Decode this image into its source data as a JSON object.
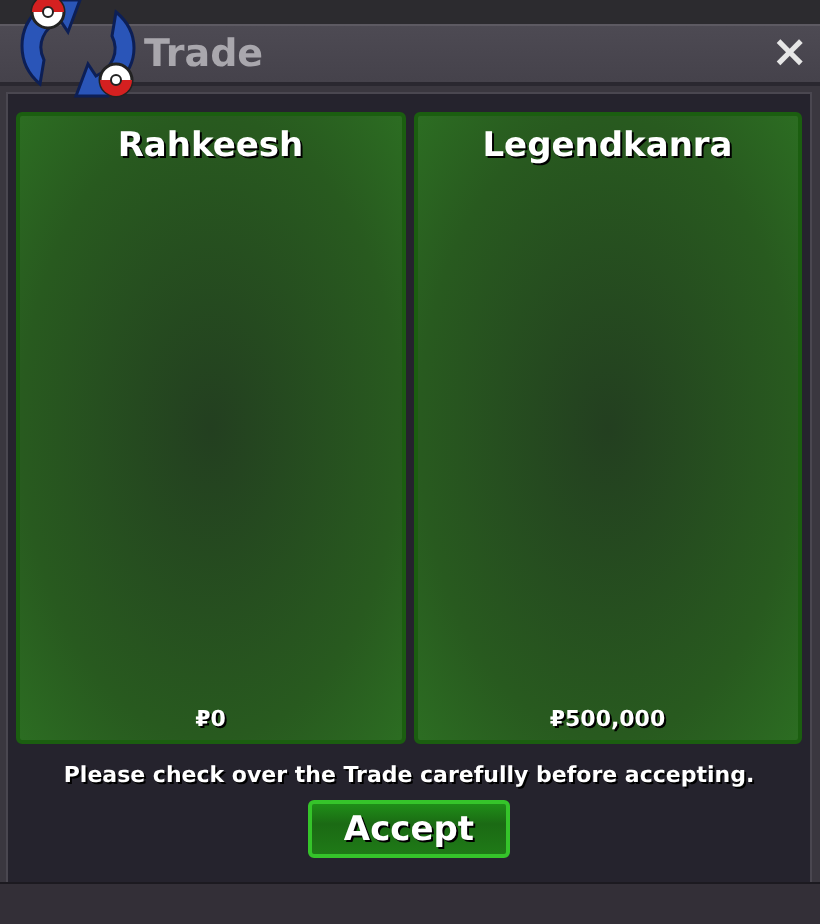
{
  "window": {
    "title": "Trade",
    "close": "×"
  },
  "offers": [
    {
      "name": "Rahkeesh",
      "money": "₽0"
    },
    {
      "name": "Legendkanra",
      "money": "₽500,000"
    }
  ],
  "notice": "Please check over the Trade carefully before accepting.",
  "buttons": [
    "Accept"
  ]
}
